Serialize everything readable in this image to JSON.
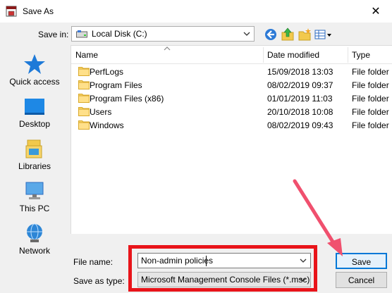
{
  "window": {
    "title": "Save As",
    "close_glyph": "✕"
  },
  "save_in": {
    "label": "Save in:",
    "value": "Local Disk (C:)"
  },
  "toolbar": {
    "icons": [
      "back-icon",
      "up-folder-icon",
      "new-folder-icon",
      "view-menu-icon"
    ]
  },
  "places": [
    {
      "label": "Quick access",
      "icon": "star-icon"
    },
    {
      "label": "Desktop",
      "icon": "desktop-icon"
    },
    {
      "label": "Libraries",
      "icon": "libraries-icon"
    },
    {
      "label": "This PC",
      "icon": "computer-icon"
    },
    {
      "label": "Network",
      "icon": "network-icon"
    }
  ],
  "columns": {
    "name": "Name",
    "date": "Date modified",
    "type": "Type"
  },
  "files": [
    {
      "name": "PerfLogs",
      "date": "15/09/2018 13:03",
      "type": "File folder"
    },
    {
      "name": "Program Files",
      "date": "08/02/2019 09:37",
      "type": "File folder"
    },
    {
      "name": "Program Files (x86)",
      "date": "01/01/2019 11:03",
      "type": "File folder"
    },
    {
      "name": "Users",
      "date": "20/10/2018 10:08",
      "type": "File folder"
    },
    {
      "name": "Windows",
      "date": "08/02/2019 09:43",
      "type": "File folder"
    }
  ],
  "form": {
    "file_name_label": "File name:",
    "file_name_value": "Non-admin policies",
    "save_as_type_label": "Save as type:",
    "save_as_type_value": "Microsoft Management Console Files (*.msc)"
  },
  "buttons": {
    "save": "Save",
    "cancel": "Cancel"
  },
  "annotation": {
    "highlight_color": "#e8141a",
    "arrow_color": "#f0506e"
  }
}
